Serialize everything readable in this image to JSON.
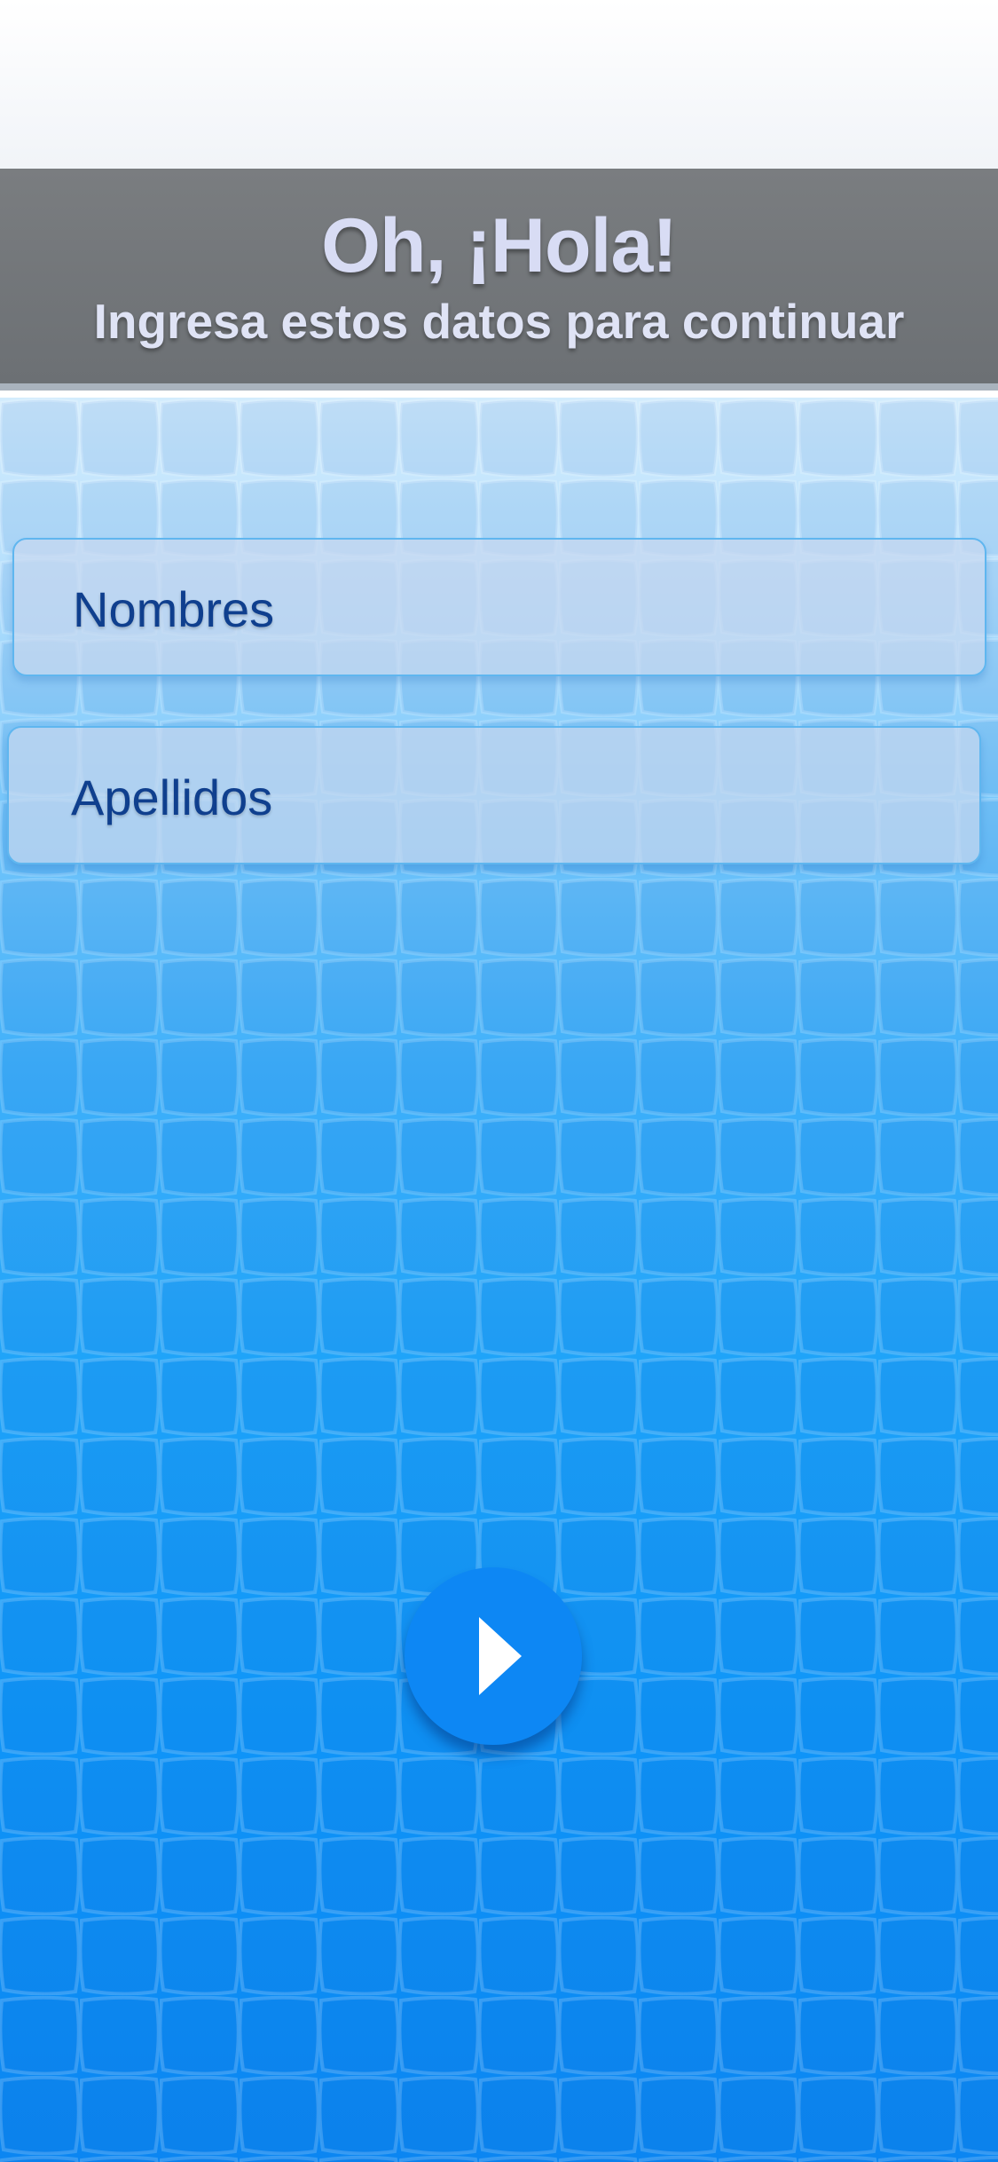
{
  "header": {
    "title": "Oh, ¡Hola!",
    "subtitle": "Ingresa estos datos para continuar"
  },
  "form": {
    "first_name": {
      "placeholder": "Nombres",
      "value": ""
    },
    "last_name": {
      "placeholder": "Apellidos",
      "value": ""
    }
  },
  "next_button": {
    "icon": "play-arrow-icon"
  },
  "colors": {
    "header_background": "#6f7377",
    "header_text": "#d8dcf4",
    "field_text": "#0f3f8e",
    "button_background": "#0d87f4"
  }
}
